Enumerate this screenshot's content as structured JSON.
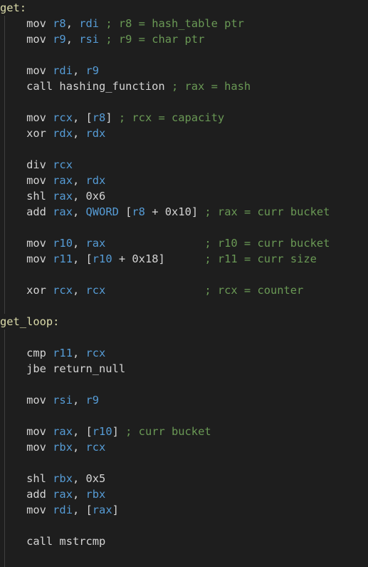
{
  "code": [
    [
      {
        "t": "label",
        "v": "get:"
      }
    ],
    [
      {
        "t": "sp",
        "v": "    "
      },
      {
        "t": "instr",
        "v": "mov "
      },
      {
        "t": "reg",
        "v": "r8"
      },
      {
        "t": "punct",
        "v": ", "
      },
      {
        "t": "reg",
        "v": "rdi"
      },
      {
        "t": "punct",
        "v": " "
      },
      {
        "t": "comment",
        "v": "; r8 = hash_table ptr"
      }
    ],
    [
      {
        "t": "sp",
        "v": "    "
      },
      {
        "t": "instr",
        "v": "mov "
      },
      {
        "t": "reg",
        "v": "r9"
      },
      {
        "t": "punct",
        "v": ", "
      },
      {
        "t": "reg",
        "v": "rsi"
      },
      {
        "t": "punct",
        "v": " "
      },
      {
        "t": "comment",
        "v": "; r9 = char ptr"
      }
    ],
    [],
    [
      {
        "t": "sp",
        "v": "    "
      },
      {
        "t": "instr",
        "v": "mov "
      },
      {
        "t": "reg",
        "v": "rdi"
      },
      {
        "t": "punct",
        "v": ", "
      },
      {
        "t": "reg",
        "v": "r9"
      }
    ],
    [
      {
        "t": "sp",
        "v": "    "
      },
      {
        "t": "instr",
        "v": "call "
      },
      {
        "t": "ident",
        "v": "hashing_function"
      },
      {
        "t": "punct",
        "v": " "
      },
      {
        "t": "comment",
        "v": "; rax = hash"
      }
    ],
    [],
    [
      {
        "t": "sp",
        "v": "    "
      },
      {
        "t": "instr",
        "v": "mov "
      },
      {
        "t": "reg",
        "v": "rcx"
      },
      {
        "t": "punct",
        "v": ", ["
      },
      {
        "t": "reg",
        "v": "r8"
      },
      {
        "t": "punct",
        "v": "] "
      },
      {
        "t": "comment",
        "v": "; rcx = capacity"
      }
    ],
    [
      {
        "t": "sp",
        "v": "    "
      },
      {
        "t": "instr",
        "v": "xor "
      },
      {
        "t": "reg",
        "v": "rdx"
      },
      {
        "t": "punct",
        "v": ", "
      },
      {
        "t": "reg",
        "v": "rdx"
      }
    ],
    [],
    [
      {
        "t": "sp",
        "v": "    "
      },
      {
        "t": "instr",
        "v": "div "
      },
      {
        "t": "reg",
        "v": "rcx"
      }
    ],
    [
      {
        "t": "sp",
        "v": "    "
      },
      {
        "t": "instr",
        "v": "mov "
      },
      {
        "t": "reg",
        "v": "rax"
      },
      {
        "t": "punct",
        "v": ", "
      },
      {
        "t": "reg",
        "v": "rdx"
      }
    ],
    [
      {
        "t": "sp",
        "v": "    "
      },
      {
        "t": "instr",
        "v": "shl "
      },
      {
        "t": "reg",
        "v": "rax"
      },
      {
        "t": "punct",
        "v": ", "
      },
      {
        "t": "num",
        "v": "0x6"
      }
    ],
    [
      {
        "t": "sp",
        "v": "    "
      },
      {
        "t": "instr",
        "v": "add "
      },
      {
        "t": "reg",
        "v": "rax"
      },
      {
        "t": "punct",
        "v": ", "
      },
      {
        "t": "kw",
        "v": "QWORD"
      },
      {
        "t": "punct",
        "v": " ["
      },
      {
        "t": "reg",
        "v": "r8"
      },
      {
        "t": "punct",
        "v": " + "
      },
      {
        "t": "num",
        "v": "0x10"
      },
      {
        "t": "punct",
        "v": "] "
      },
      {
        "t": "comment",
        "v": "; rax = curr bucket"
      }
    ],
    [],
    [
      {
        "t": "sp",
        "v": "    "
      },
      {
        "t": "instr",
        "v": "mov "
      },
      {
        "t": "reg",
        "v": "r10"
      },
      {
        "t": "punct",
        "v": ", "
      },
      {
        "t": "reg",
        "v": "rax"
      },
      {
        "t": "punct",
        "v": "               "
      },
      {
        "t": "comment",
        "v": "; r10 = curr bucket"
      }
    ],
    [
      {
        "t": "sp",
        "v": "    "
      },
      {
        "t": "instr",
        "v": "mov "
      },
      {
        "t": "reg",
        "v": "r11"
      },
      {
        "t": "punct",
        "v": ", ["
      },
      {
        "t": "reg",
        "v": "r10"
      },
      {
        "t": "punct",
        "v": " + "
      },
      {
        "t": "num",
        "v": "0x18"
      },
      {
        "t": "punct",
        "v": "]      "
      },
      {
        "t": "comment",
        "v": "; r11 = curr size"
      }
    ],
    [],
    [
      {
        "t": "sp",
        "v": "    "
      },
      {
        "t": "instr",
        "v": "xor "
      },
      {
        "t": "reg",
        "v": "rcx"
      },
      {
        "t": "punct",
        "v": ", "
      },
      {
        "t": "reg",
        "v": "rcx"
      },
      {
        "t": "punct",
        "v": "               "
      },
      {
        "t": "comment",
        "v": "; rcx = counter"
      }
    ],
    [],
    [
      {
        "t": "label",
        "v": "get_loop:"
      }
    ],
    [],
    [
      {
        "t": "sp",
        "v": "    "
      },
      {
        "t": "instr",
        "v": "cmp "
      },
      {
        "t": "reg",
        "v": "r11"
      },
      {
        "t": "punct",
        "v": ", "
      },
      {
        "t": "reg",
        "v": "rcx"
      }
    ],
    [
      {
        "t": "sp",
        "v": "    "
      },
      {
        "t": "instr",
        "v": "jbe "
      },
      {
        "t": "ident",
        "v": "return_null"
      }
    ],
    [],
    [
      {
        "t": "sp",
        "v": "    "
      },
      {
        "t": "instr",
        "v": "mov "
      },
      {
        "t": "reg",
        "v": "rsi"
      },
      {
        "t": "punct",
        "v": ", "
      },
      {
        "t": "reg",
        "v": "r9"
      }
    ],
    [],
    [
      {
        "t": "sp",
        "v": "    "
      },
      {
        "t": "instr",
        "v": "mov "
      },
      {
        "t": "reg",
        "v": "rax"
      },
      {
        "t": "punct",
        "v": ", ["
      },
      {
        "t": "reg",
        "v": "r10"
      },
      {
        "t": "punct",
        "v": "] "
      },
      {
        "t": "comment",
        "v": "; curr bucket"
      }
    ],
    [
      {
        "t": "sp",
        "v": "    "
      },
      {
        "t": "instr",
        "v": "mov "
      },
      {
        "t": "reg",
        "v": "rbx"
      },
      {
        "t": "punct",
        "v": ", "
      },
      {
        "t": "reg",
        "v": "rcx"
      }
    ],
    [],
    [
      {
        "t": "sp",
        "v": "    "
      },
      {
        "t": "instr",
        "v": "shl "
      },
      {
        "t": "reg",
        "v": "rbx"
      },
      {
        "t": "punct",
        "v": ", "
      },
      {
        "t": "num",
        "v": "0x5"
      }
    ],
    [
      {
        "t": "sp",
        "v": "    "
      },
      {
        "t": "instr",
        "v": "add "
      },
      {
        "t": "reg",
        "v": "rax"
      },
      {
        "t": "punct",
        "v": ", "
      },
      {
        "t": "reg",
        "v": "rbx"
      }
    ],
    [
      {
        "t": "sp",
        "v": "    "
      },
      {
        "t": "instr",
        "v": "mov "
      },
      {
        "t": "reg",
        "v": "rdi"
      },
      {
        "t": "punct",
        "v": ", ["
      },
      {
        "t": "reg",
        "v": "rax"
      },
      {
        "t": "punct",
        "v": "]"
      }
    ],
    [],
    [
      {
        "t": "sp",
        "v": "    "
      },
      {
        "t": "instr",
        "v": "call "
      },
      {
        "t": "ident",
        "v": "mstrcmp"
      }
    ],
    []
  ]
}
